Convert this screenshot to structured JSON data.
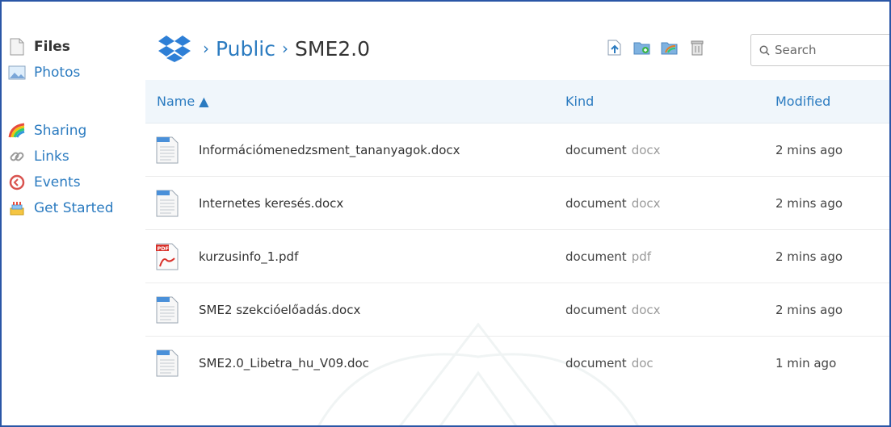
{
  "sidebar": {
    "items": [
      {
        "label": "Files",
        "icon": "files-icon"
      },
      {
        "label": "Photos",
        "icon": "photos-icon"
      },
      {
        "label": "Sharing",
        "icon": "sharing-icon"
      },
      {
        "label": "Links",
        "icon": "links-icon"
      },
      {
        "label": "Events",
        "icon": "events-icon"
      },
      {
        "label": "Get Started",
        "icon": "get-started-icon"
      }
    ]
  },
  "breadcrumb": {
    "separator1": "›",
    "folder1": "Public",
    "separator2": "›",
    "current": "SME2.0"
  },
  "search": {
    "placeholder": "Search"
  },
  "table": {
    "headers": {
      "name": "Name ▲",
      "kind": "Kind",
      "modified": "Modified"
    },
    "rows": [
      {
        "name": "Információmenedzsment_tananyagok.docx",
        "kind": "document",
        "ext": "docx",
        "modified": "2 mins ago",
        "type": "word"
      },
      {
        "name": "Internetes keresés.docx",
        "kind": "document",
        "ext": "docx",
        "modified": "2 mins ago",
        "type": "word"
      },
      {
        "name": "kurzusinfo_1.pdf",
        "kind": "document",
        "ext": "pdf",
        "modified": "2 mins ago",
        "type": "pdf"
      },
      {
        "name": "SME2 szekcióelőadás.docx",
        "kind": "document",
        "ext": "docx",
        "modified": "2 mins ago",
        "type": "word"
      },
      {
        "name": "SME2.0_Libetra_hu_V09.doc",
        "kind": "document",
        "ext": "doc",
        "modified": "1 min ago",
        "type": "word"
      }
    ]
  },
  "colors": {
    "link": "#2b7bc0",
    "header_bg": "#f0f6fb",
    "frame_border": "#2a56a6",
    "dropbox_blue": "#2e7fd6"
  }
}
